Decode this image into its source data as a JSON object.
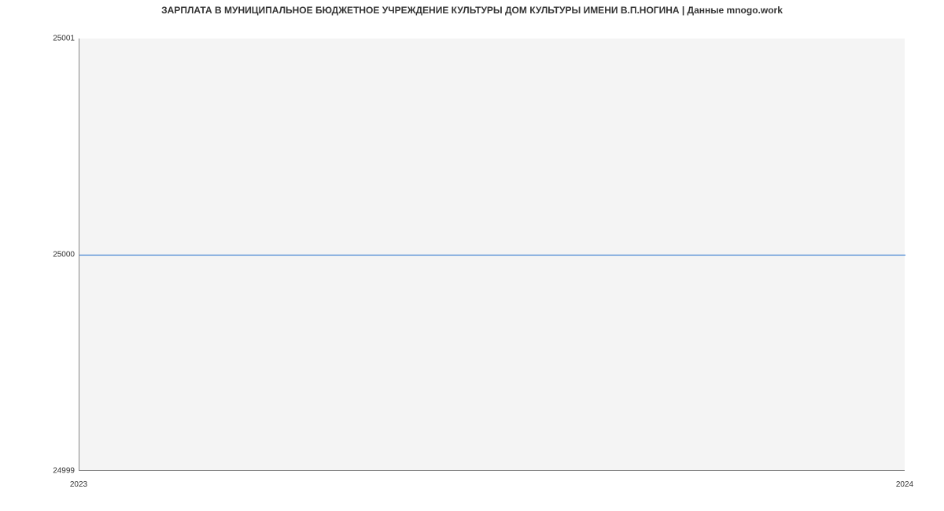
{
  "chart_data": {
    "type": "line",
    "title": "ЗАРПЛАТА В МУНИЦИПАЛЬНОЕ БЮДЖЕТНОЕ УЧРЕЖДЕНИЕ КУЛЬТУРЫ ДОМ КУЛЬТУРЫ ИМЕНИ В.П.НОГИНА | Данные mnogo.work",
    "x": [
      2023,
      2024
    ],
    "values": [
      25000,
      25000
    ],
    "xlabel": "",
    "ylabel": "",
    "xlim": [
      2023,
      2024
    ],
    "ylim": [
      24999,
      25001
    ],
    "x_ticks": [
      "2023",
      "2024"
    ],
    "y_ticks": [
      "24999",
      "25000",
      "25001"
    ]
  }
}
